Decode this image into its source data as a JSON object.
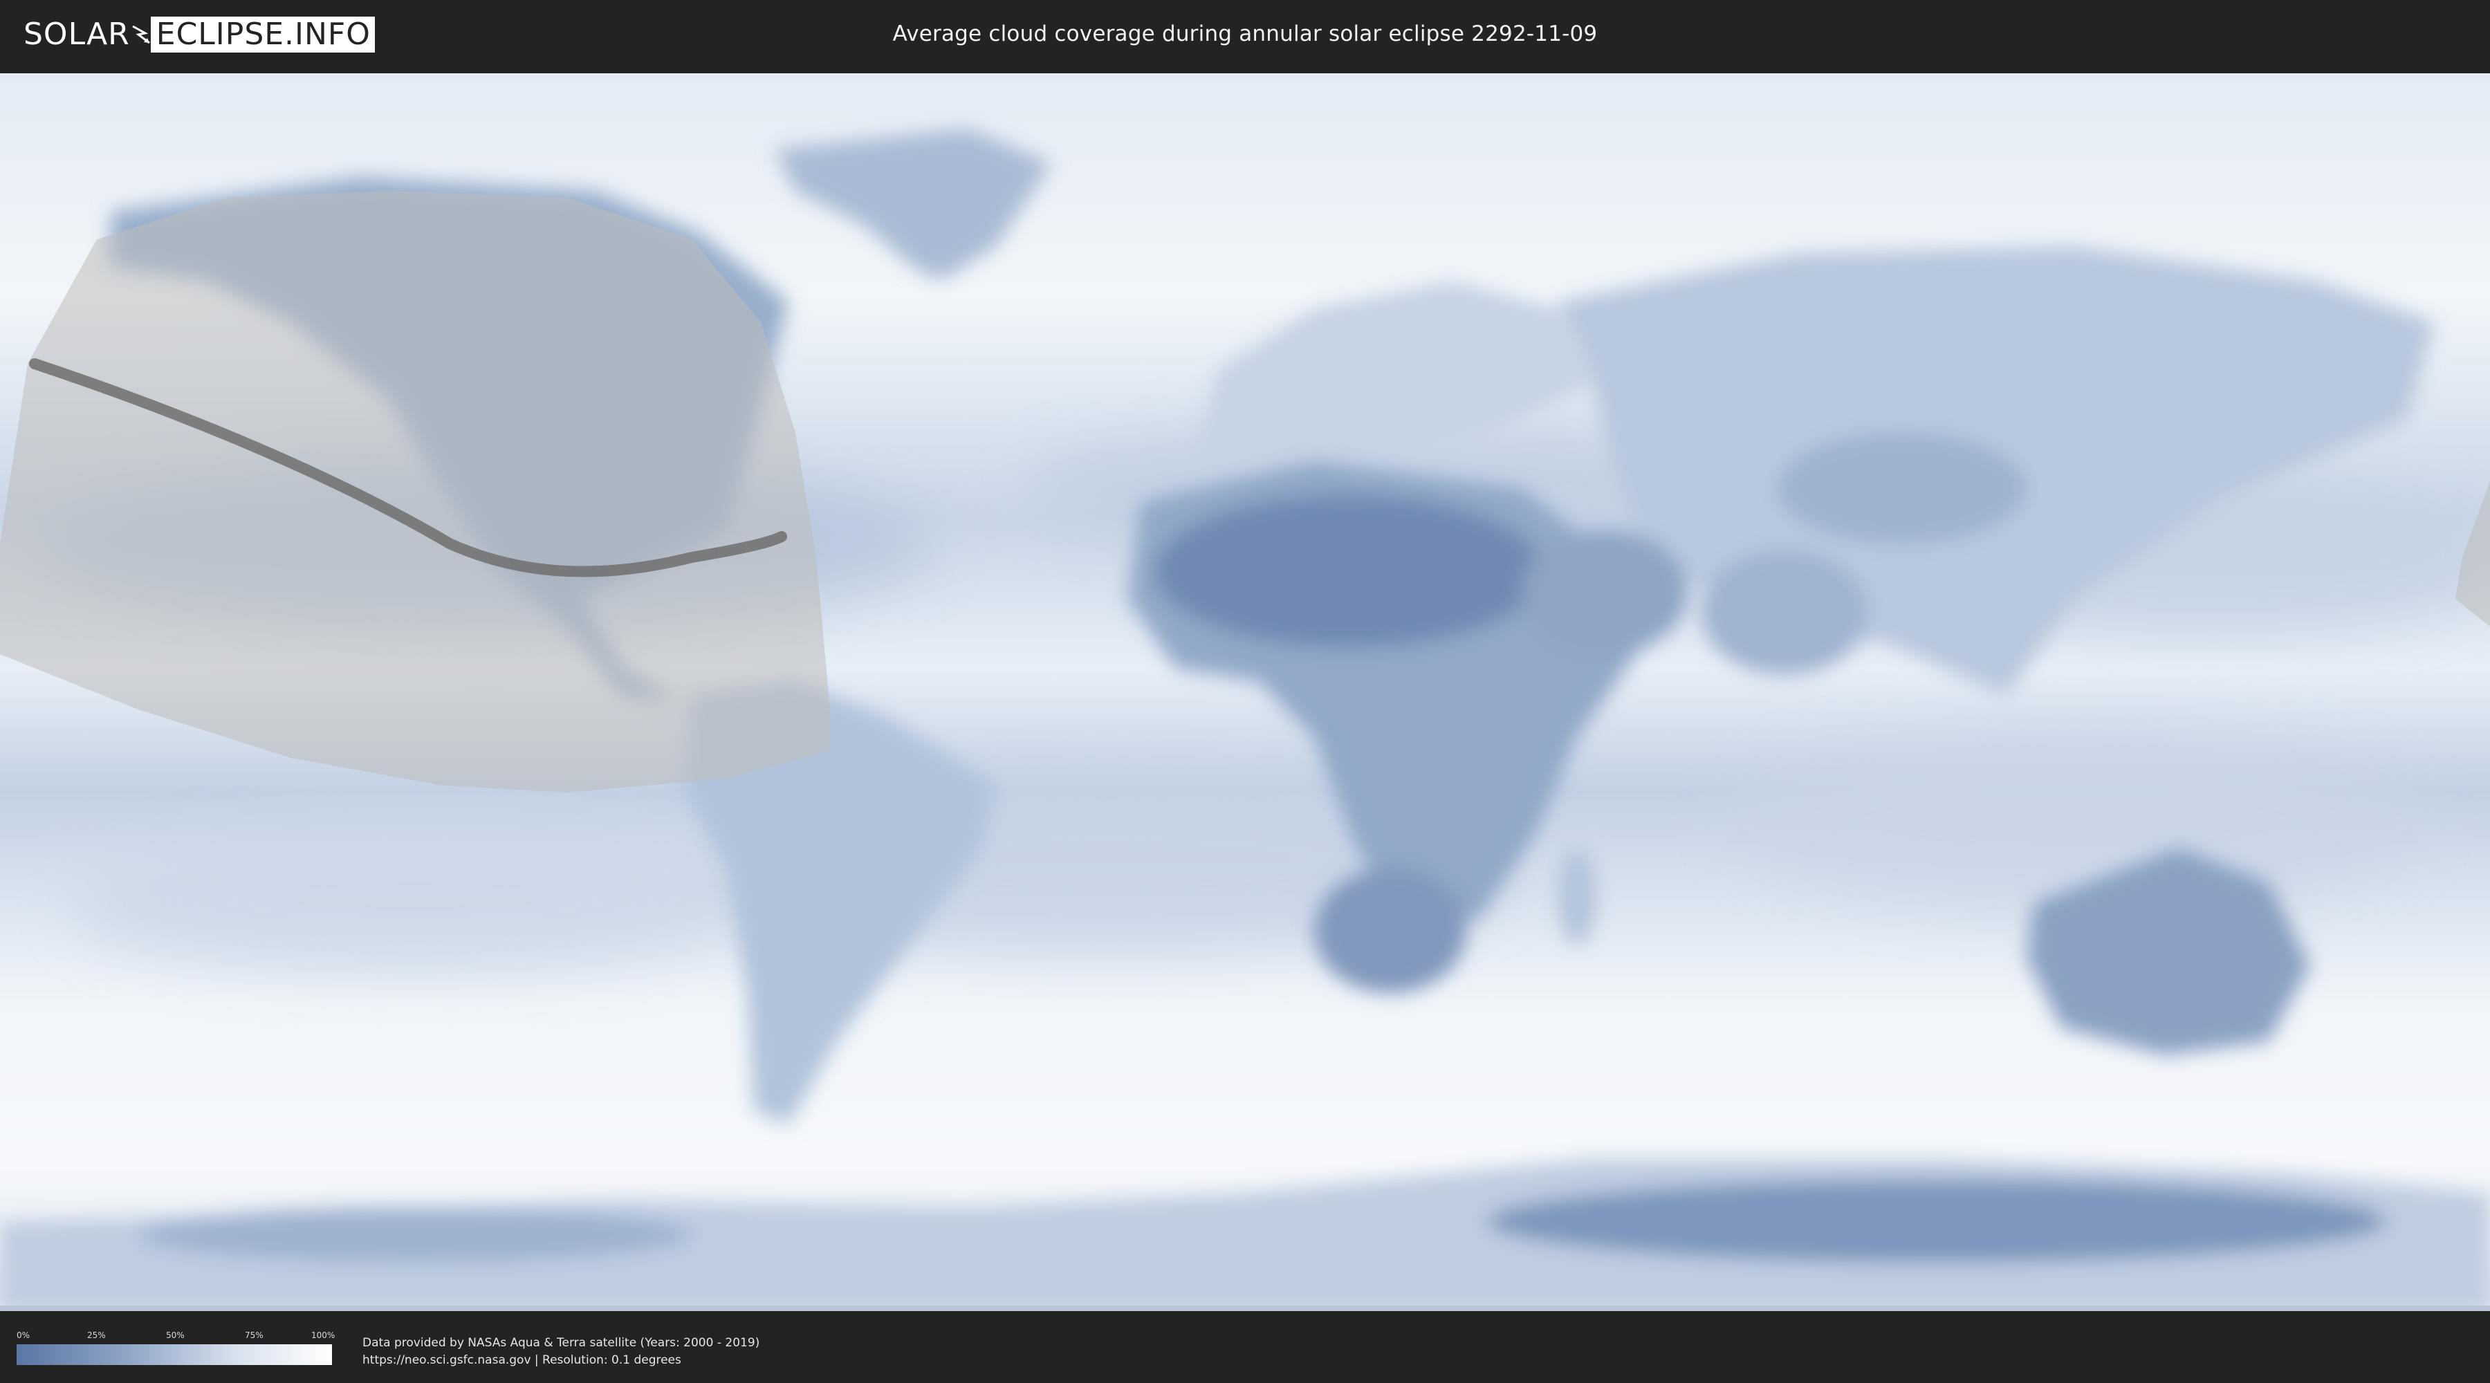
{
  "header": {
    "logo_left": "SOLAR",
    "logo_right": "ECLIPSE.INFO",
    "title": "Average cloud coverage during annular solar eclipse 2292-11-09"
  },
  "map": {
    "type": "equirectangular world cloud coverage map",
    "eclipse_type": "annular",
    "date": "2292-11-09",
    "colors": {
      "clear_sky": "#5a76a3",
      "overcast": "#ffffff",
      "eclipse_region": "#bdbdbd",
      "central_path": "#666666"
    }
  },
  "legend": {
    "ticks": [
      "0%",
      "25%",
      "50%",
      "75%",
      "100%"
    ]
  },
  "footer": {
    "credit_line1": "Data provided by NASAs Aqua & Terra satellite (Years: 2000 - 2019)",
    "credit_line2": "https://neo.sci.gsfc.nasa.gov | Resolution: 0.1 degrees"
  }
}
